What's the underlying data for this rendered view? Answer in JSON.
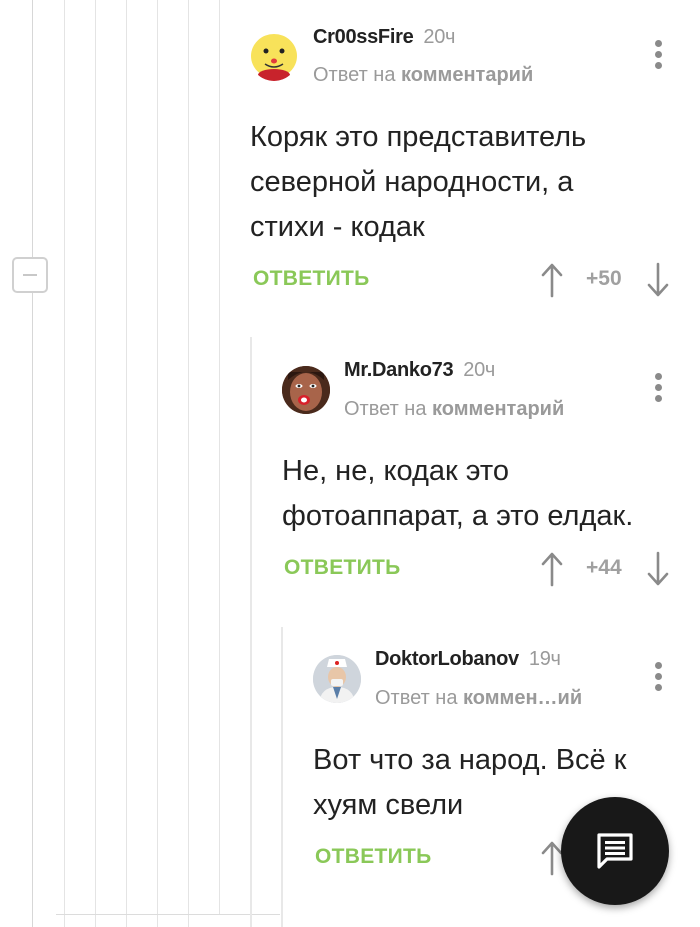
{
  "comments": [
    {
      "username": "Cr00ssFire",
      "time": "20ч",
      "reply_prefix": "Ответ на",
      "reply_link": "комментарий",
      "text_lines": [
        "Коряк это представитель",
        "северной народности, а",
        "стихи - кодак"
      ],
      "reply_label": "ОТВЕТИТЬ",
      "rating": "+50",
      "avatar_icon": "smiley-avatar-icon"
    },
    {
      "username": "Mr.Danko73",
      "time": "20ч",
      "reply_prefix": "Ответ на",
      "reply_link": "комментарий",
      "text_lines": [
        "Не, не, кодак это",
        "фотоаппарат, а это елдак."
      ],
      "reply_label": "ОТВЕТИТЬ",
      "rating": "+44",
      "avatar_icon": "face-avatar-icon"
    },
    {
      "username": "DoktorLobanov",
      "time": "19ч",
      "reply_prefix": "Ответ на",
      "reply_link": "коммен…ий",
      "text_lines": [
        "Вот что за народ. Всё к",
        "хуям свели"
      ],
      "reply_label": "ОТВЕТИТЬ",
      "rating": "",
      "avatar_icon": "doctor-avatar-icon"
    }
  ],
  "icons": {
    "collapse": "minus-icon",
    "menu": "more-vertical-icon",
    "upvote": "arrow-up-icon",
    "downvote": "arrow-down-icon",
    "fab": "comment-icon"
  },
  "colors": {
    "reply_green": "#8ac858",
    "muted": "#9a9a9a",
    "fab_bg": "#181818"
  }
}
